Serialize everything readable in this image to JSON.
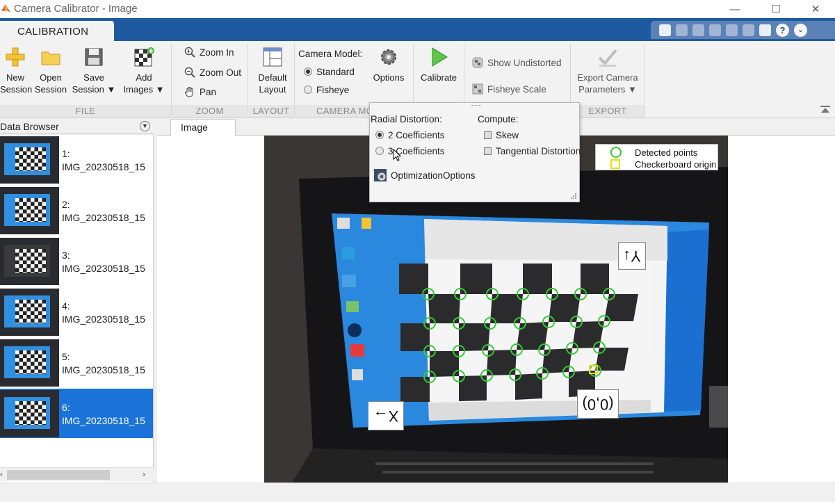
{
  "window": {
    "title": "Camera Calibrator - Image",
    "minimize": "—",
    "maximize": "☐",
    "close": "✕"
  },
  "ribbon": {
    "tab": "CALIBRATION",
    "file": {
      "group_label": "FILE",
      "new_session": [
        "New",
        "Session"
      ],
      "open_session": [
        "Open",
        "Session"
      ],
      "save_session": [
        "Save",
        "Session ▼"
      ],
      "add_images": [
        "Add",
        "Images ▼"
      ]
    },
    "zoom": {
      "group_label": "ZOOM",
      "zoom_in": "Zoom In",
      "zoom_out": "Zoom Out",
      "pan": "Pan"
    },
    "layout": {
      "group_label": "LAYOUT",
      "default_layout": [
        "Default",
        "Layout"
      ]
    },
    "camera_model": {
      "group_label": "CAMERA MO",
      "label": "Camera Model:",
      "standard": "Standard",
      "fisheye": "Fisheye",
      "options": "Options"
    },
    "calibrate": "Calibrate",
    "view": {
      "show_undistorted": "Show Undistorted",
      "fisheye_scale": "Fisheye Scale"
    },
    "export": {
      "group_label": "EXPORT",
      "export_camera": [
        "Export Camera",
        "Parameters ▼"
      ]
    }
  },
  "options_panel": {
    "radial_label": "Radial Distortion:",
    "two_coeff": "2 Coefficients",
    "three_coeff": "3 Coefficients",
    "compute_label": "Compute:",
    "skew": "Skew",
    "tangential": "Tangential Distortion",
    "optimization": "OptimizationOptions"
  },
  "data_browser": {
    "title": "Data Browser",
    "items": [
      {
        "index": "1:",
        "name": "IMG_20230518_15"
      },
      {
        "index": "2:",
        "name": "IMG_20230518_15"
      },
      {
        "index": "3:",
        "name": "IMG_20230518_15"
      },
      {
        "index": "4:",
        "name": "IMG_20230518_15"
      },
      {
        "index": "5:",
        "name": "IMG_20230518_15"
      },
      {
        "index": "6:",
        "name": "IMG_20230518_15"
      }
    ],
    "selected_index": 5
  },
  "image_panel": {
    "tab": "Image",
    "legend": {
      "detected": "Detected points",
      "origin": "Checkerboard origin"
    },
    "axis_y": "Y↓",
    "axis_x": "X→",
    "origin_label": "(0,0)"
  },
  "colors": {
    "ribbon_blue": "#1f5aa0",
    "selection_blue": "#1a73d9",
    "detected_green": "#33cc33",
    "origin_yellow": "#e6e000"
  }
}
